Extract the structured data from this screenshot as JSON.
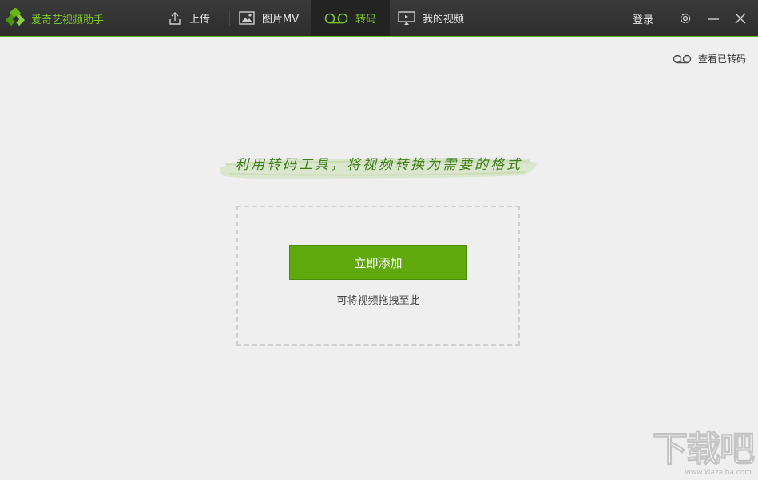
{
  "app": {
    "title": "爱奇艺视频助手"
  },
  "nav": {
    "tabs": [
      {
        "label": "上传",
        "icon": "upload-icon"
      },
      {
        "label": "图片MV",
        "icon": "image-icon"
      },
      {
        "label": "转码",
        "icon": "transcode-icon",
        "active": true
      },
      {
        "label": "我的视频",
        "icon": "monitor-icon"
      }
    ],
    "login": "登录"
  },
  "toolbar": {
    "view_transcoded": "查看已转码"
  },
  "main": {
    "slogan": "利用转码工具，将视频转换为需要的格式",
    "add_button": "立即添加",
    "drop_hint": "可将视频拖拽至此"
  },
  "watermark": {
    "text": "下载吧",
    "url": "www.xiazaiba.com"
  },
  "colors": {
    "accent": "#5fa90d",
    "titlebar": "#2d2d2d",
    "background": "#efefef"
  }
}
